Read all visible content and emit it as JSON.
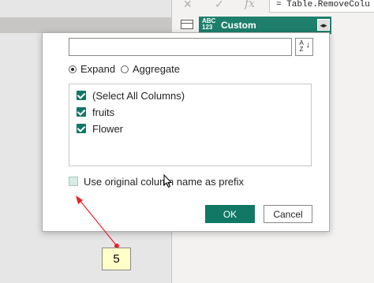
{
  "editor": {
    "fx_label": "fx",
    "formula_text": "= Table.RemoveColu",
    "column_type_badge_top": "ABC",
    "column_type_badge_bottom": "123",
    "column_header": "Custom",
    "expand_icon": "expand-columns-icon"
  },
  "dialog": {
    "search": {
      "value": "",
      "placeholder": ""
    },
    "sort_button_label": "A Z",
    "mode_options": [
      {
        "label": "Expand",
        "selected": true
      },
      {
        "label": "Aggregate",
        "selected": false
      }
    ],
    "columns": [
      {
        "label": "(Select All Columns)",
        "checked": true
      },
      {
        "label": "fruits",
        "checked": true
      },
      {
        "label": "Flower",
        "checked": true
      }
    ],
    "prefix_label": "Use original column name as prefix",
    "prefix_checked": false,
    "ok_label": "OK",
    "cancel_label": "Cancel"
  },
  "annotation": {
    "step_number": "5",
    "arrow_color": "#e8202a",
    "callout_color": "#ffffc8"
  },
  "colors": {
    "accent": "#117865",
    "column_header": "#1d7f6c"
  }
}
